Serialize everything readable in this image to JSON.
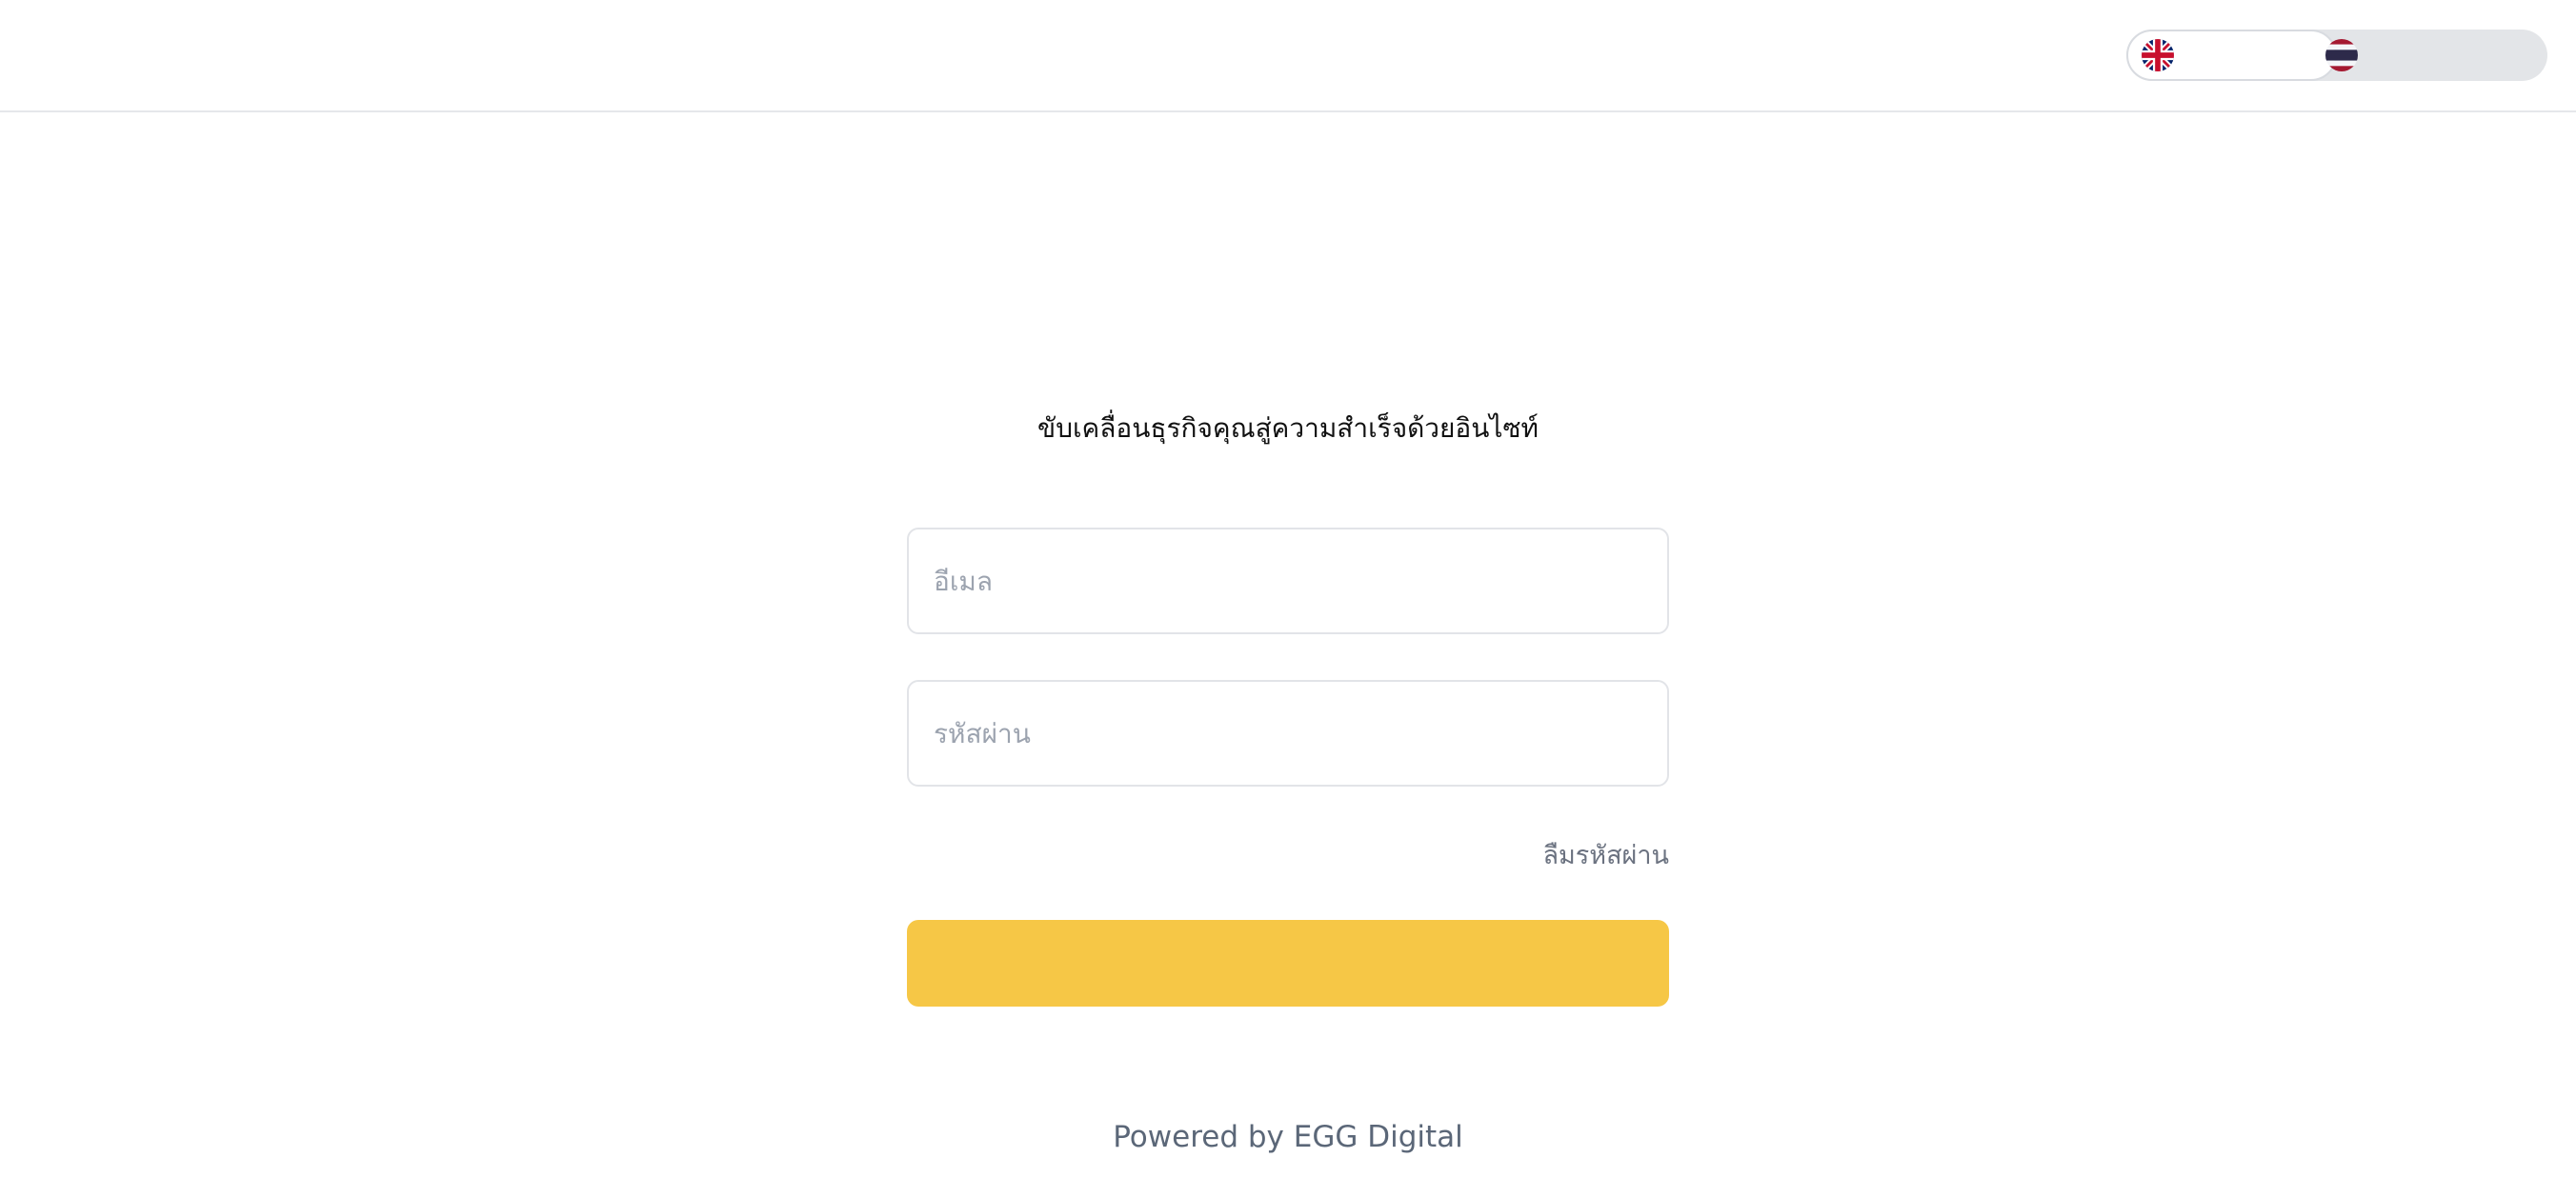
{
  "header": {
    "languages": [
      {
        "code": "en",
        "label": "",
        "icon": "uk-flag-icon",
        "selected": true
      },
      {
        "code": "th",
        "label": "",
        "icon": "thailand-flag-icon",
        "selected": false
      }
    ]
  },
  "login": {
    "tagline": "ขับเคลื่อนธุรกิจคุณสู่ความสำเร็จด้วยอินไซท์",
    "email": {
      "placeholder": "อีเมล",
      "value": ""
    },
    "password": {
      "placeholder": "รหัสผ่าน",
      "value": ""
    },
    "forgot_label": "ลืมรหัสผ่าน",
    "submit_label": "",
    "submit_color": "#f6c746"
  },
  "footer": {
    "powered_by": "Powered by EGG Digital"
  },
  "colors": {
    "accent": "#f6c746",
    "toggle_bg": "#e3e5e8",
    "muted_text": "#6b7280"
  }
}
